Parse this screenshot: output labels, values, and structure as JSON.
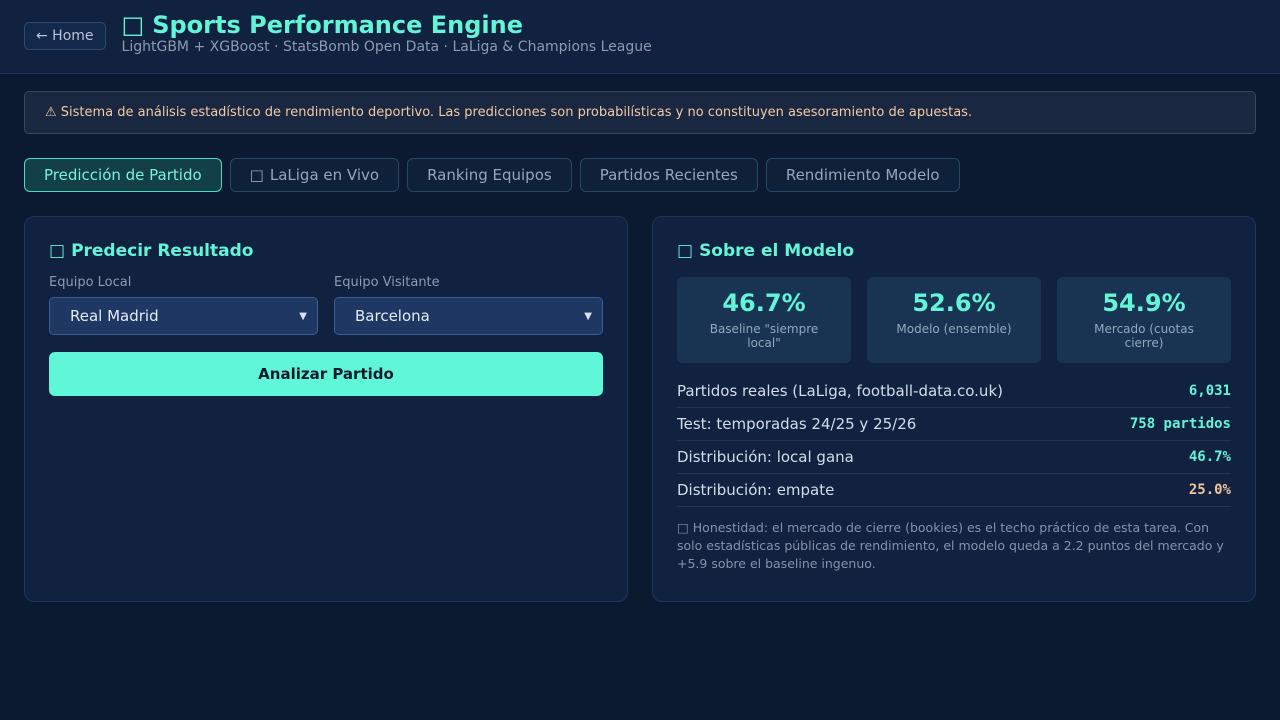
{
  "header": {
    "home_label": "← Home",
    "title_icon": "□",
    "title": "Sports Performance Engine",
    "subtitle": "LightGBM + XGBoost · StatsBomb Open Data · LaLiga & Champions League"
  },
  "warning": "⚠ Sistema de análisis estadístico de rendimiento deportivo. Las predicciones son probabilísticas y no constituyen asesoramiento de apuestas.",
  "tabs": [
    {
      "label": "Predicción de Partido",
      "icon": ""
    },
    {
      "label": "LaLiga en Vivo",
      "icon": "□"
    },
    {
      "label": "Ranking Equipos",
      "icon": ""
    },
    {
      "label": "Partidos Recientes",
      "icon": ""
    },
    {
      "label": "Rendimiento Modelo",
      "icon": ""
    }
  ],
  "predict": {
    "icon": "□",
    "title": "Predecir Resultado",
    "home_label": "Equipo Local",
    "home_value": "Real Madrid",
    "away_label": "Equipo Visitante",
    "away_value": "Barcelona",
    "button": "Analizar Partido"
  },
  "model": {
    "icon": "□",
    "title": "Sobre el Modelo",
    "stats": [
      {
        "value": "46.7%",
        "label": "Baseline \"siempre local\""
      },
      {
        "value": "52.6%",
        "label": "Modelo (ensemble)"
      },
      {
        "value": "54.9%",
        "label": "Mercado (cuotas cierre)"
      }
    ],
    "rows": [
      {
        "key": "Partidos reales (LaLiga, football-data.co.uk)",
        "value": "6,031"
      },
      {
        "key": "Test: temporadas 24/25 y 25/26",
        "value": "758 partidos"
      },
      {
        "key": "Distribución: local gana",
        "value": "46.7%"
      },
      {
        "key": "Distribución: empate",
        "value": "25.0%"
      }
    ],
    "note": "□ Honestidad: el mercado de cierre (bookies) es el techo práctico de esta tarea. Con solo estadísticas públicas de rendimiento, el modelo queda a 2.2 puntos del mercado y +5.9 sobre el baseline ingenuo."
  }
}
